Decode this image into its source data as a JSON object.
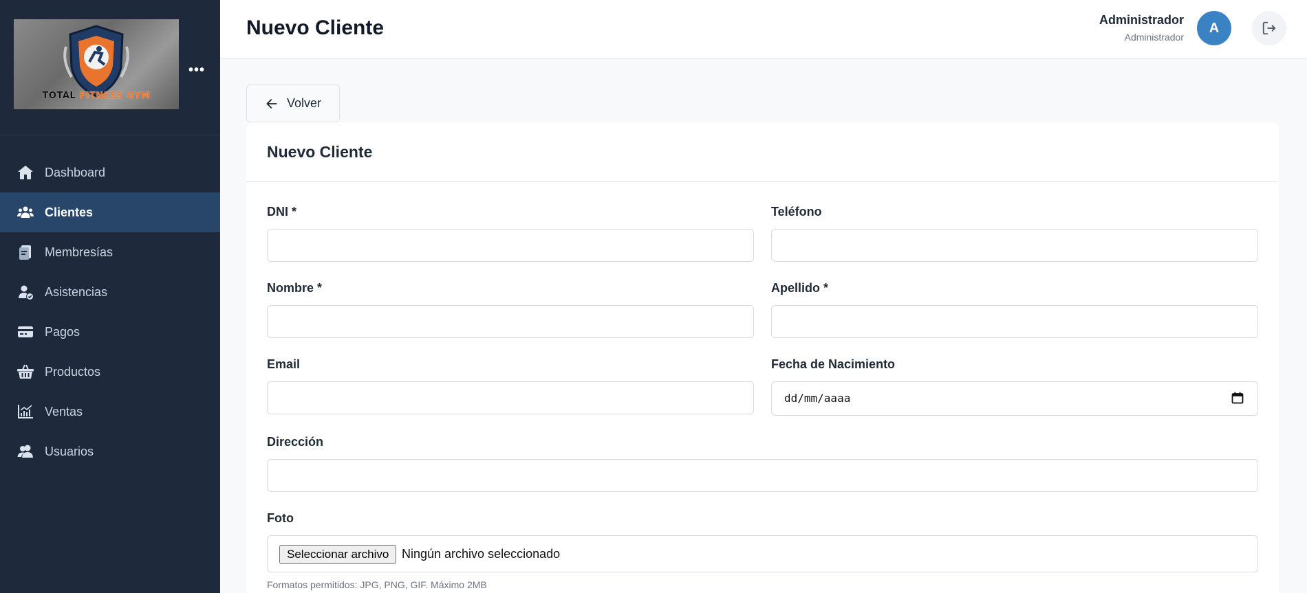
{
  "app": {
    "logo_text_main": "TOTAL",
    "logo_text_accent": "FITNESS GYM",
    "colors": {
      "sidebar_bg": "#1e293b",
      "active_bg": "#27466a",
      "accent": "#3b82c4"
    }
  },
  "sidebar": {
    "items": [
      {
        "label": "Dashboard",
        "icon": "home-icon",
        "active": false
      },
      {
        "label": "Clientes",
        "icon": "users-icon",
        "active": true
      },
      {
        "label": "Membresías",
        "icon": "card-stack-icon",
        "active": false
      },
      {
        "label": "Asistencias",
        "icon": "user-check-icon",
        "active": false
      },
      {
        "label": "Pagos",
        "icon": "credit-card-icon",
        "active": false
      },
      {
        "label": "Productos",
        "icon": "basket-icon",
        "active": false
      },
      {
        "label": "Ventas",
        "icon": "chart-line-icon",
        "active": false
      },
      {
        "label": "Usuarios",
        "icon": "user-group-icon",
        "active": false
      }
    ]
  },
  "header": {
    "title": "Nuevo Cliente",
    "user_name": "Administrador",
    "user_role": "Administrador",
    "avatar_initial": "A"
  },
  "back_button": {
    "label": "Volver"
  },
  "form": {
    "title": "Nuevo Cliente",
    "fields": {
      "dni": {
        "label": "DNI *",
        "value": ""
      },
      "telefono": {
        "label": "Teléfono",
        "value": ""
      },
      "nombre": {
        "label": "Nombre *",
        "value": ""
      },
      "apellido": {
        "label": "Apellido *",
        "value": ""
      },
      "email": {
        "label": "Email",
        "value": ""
      },
      "fecha_nacimiento": {
        "label": "Fecha de Nacimiento",
        "value": "dd/mm/aaaa"
      },
      "direccion": {
        "label": "Dirección",
        "value": ""
      },
      "foto": {
        "label": "Foto",
        "button_label": "Seleccionar archivo",
        "status": "Ningún archivo seleccionado",
        "help": "Formatos permitidos: JPG, PNG, GIF. Máximo 2MB"
      }
    }
  }
}
